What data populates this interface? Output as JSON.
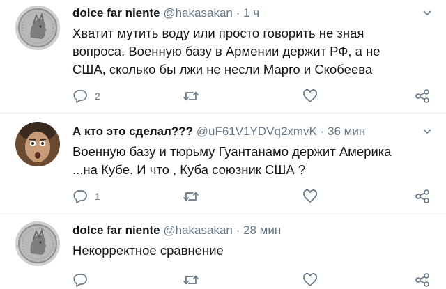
{
  "tweets": [
    {
      "author": "dolce far niente",
      "handle": "@hakasakan",
      "separator": "·",
      "time": "1 ч",
      "text": "Хватит мутить воду или просто говорить не зная\nвопроса. Военную базу в Армении держит РФ, а не\nСША, сколько бы лжи не несли Марго и Скобеева",
      "reply_count": "2",
      "retweet_count": "",
      "like_count": ""
    },
    {
      "author": "А кто это сделал???",
      "handle": "@uF61V1YDVq2xmvK",
      "separator": "·",
      "time": "36 мин",
      "text": "Военную базу и тюрьму Гуантанамо держит Америка\n...на Кубе. И что , Куба союзник США ?",
      "reply_count": "1",
      "retweet_count": "",
      "like_count": ""
    },
    {
      "author": "dolce far niente",
      "handle": "@hakasakan",
      "separator": "·",
      "time": "28 мин",
      "text": "Некорректное сравнение",
      "reply_count": "",
      "retweet_count": "",
      "like_count": ""
    }
  ],
  "icons": {
    "reply": "reply-icon",
    "retweet": "retweet-icon",
    "like": "like-icon",
    "share": "share-icon",
    "caret": "chevron-down-icon"
  },
  "colors": {
    "icon_gray": "#657786",
    "divider": "#e6ecf0",
    "text": "#14171a"
  }
}
